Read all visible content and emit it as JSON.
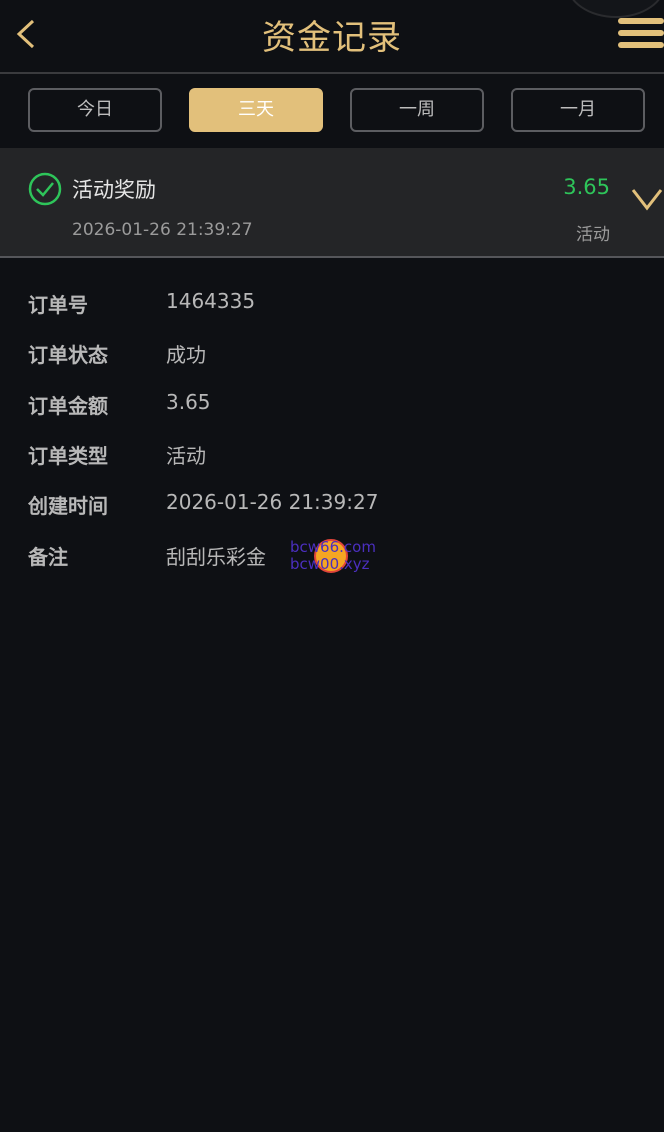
{
  "header": {
    "title": "资金记录",
    "back_icon": "chevron-left-icon",
    "menu_icon": "hamburger-menu-icon",
    "accent_color": "#e2c07b"
  },
  "tabs": [
    {
      "label": "今日",
      "active": false
    },
    {
      "label": "三天",
      "active": true
    },
    {
      "label": "一周",
      "active": false
    },
    {
      "label": "一月",
      "active": false
    }
  ],
  "record": {
    "status_icon": "check-circle-icon",
    "title": "活动奖励",
    "time": "2026-01-26 21:39:27",
    "amount": "3.65",
    "type": "活动",
    "amount_color": "#2ec55a",
    "expand_icon": "chevron-down-icon"
  },
  "details": [
    {
      "label": "订单号",
      "value": "1464335"
    },
    {
      "label": "订单状态",
      "value": "成功"
    },
    {
      "label": "订单金额",
      "value": "3.65"
    },
    {
      "label": "订单类型",
      "value": "活动"
    },
    {
      "label": "创建时间",
      "value": "2026-01-26 21:39:27"
    },
    {
      "label": "备注",
      "value": "刮刮乐彩金"
    }
  ],
  "watermark": {
    "line1": "bcw66.com",
    "line2": "bcw00.xyz"
  }
}
